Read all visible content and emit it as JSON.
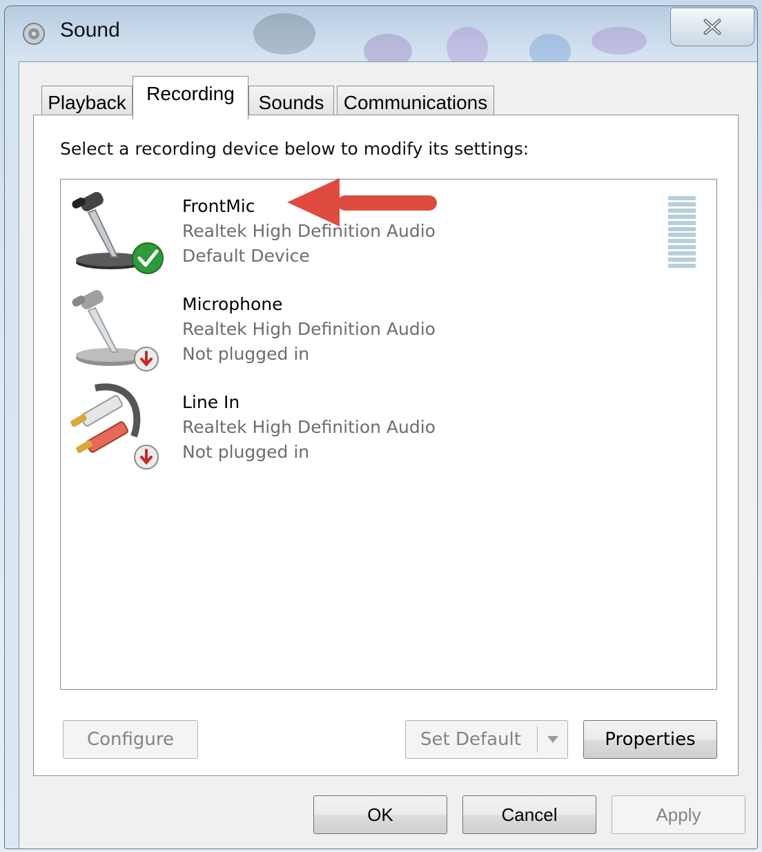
{
  "window": {
    "title": "Sound",
    "icon": "speaker-icon",
    "close_icon": "close-icon"
  },
  "tabs": [
    {
      "label": "Playback",
      "active": false
    },
    {
      "label": "Recording",
      "active": true
    },
    {
      "label": "Sounds",
      "active": false
    },
    {
      "label": "Communications",
      "active": false
    }
  ],
  "panel": {
    "instructions": "Select a recording device below to modify its settings:",
    "devices": [
      {
        "name": "FrontMic",
        "driver": "Realtek High Definition Audio",
        "status": "Default Device",
        "icon": "microphone-icon",
        "badge": "default-check-icon",
        "selected": false
      },
      {
        "name": "Microphone",
        "driver": "Realtek High Definition Audio",
        "status": "Not plugged in",
        "icon": "microphone-icon",
        "badge": "unplugged-icon"
      },
      {
        "name": "Line In",
        "driver": "Realtek High Definition Audio",
        "status": "Not plugged in",
        "icon": "line-in-cable-icon",
        "badge": "unplugged-icon"
      }
    ],
    "buttons": {
      "configure": "Configure",
      "set_default": "Set Default",
      "properties": "Properties"
    }
  },
  "dialog_buttons": {
    "ok": "OK",
    "cancel": "Cancel",
    "apply": "Apply"
  },
  "annotation": {
    "type": "red-arrow",
    "color": "#e04b3f",
    "points_to": "FrontMic"
  },
  "colors": {
    "arrow": "#e04b3f",
    "secondary_text": "#6d6d6d",
    "meter": "#b5cfda"
  }
}
